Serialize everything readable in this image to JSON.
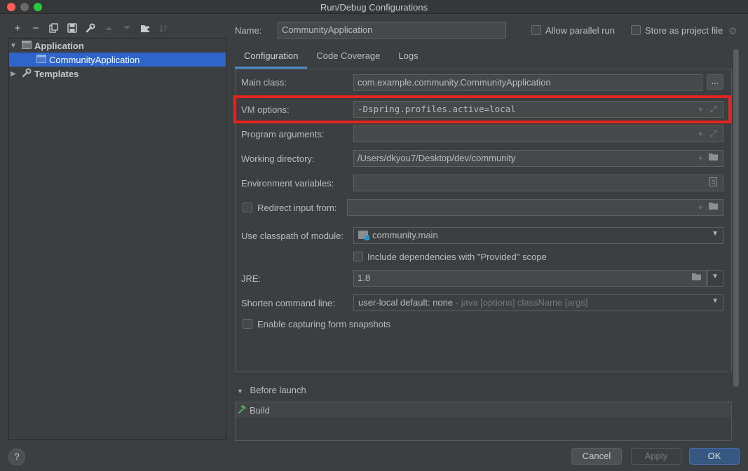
{
  "window": {
    "title": "Run/Debug Configurations"
  },
  "toolbar": {
    "add_icon": "+",
    "remove_icon": "−",
    "copy_icon": "⧉",
    "save_icon": "💾",
    "wrench_icon": "🔧",
    "up_icon": "▲",
    "down_icon": "▼",
    "folder_icon": "📁",
    "sort_icon": "⇅"
  },
  "tree": {
    "group": "Application",
    "item": "CommunityApplication",
    "templates": "Templates"
  },
  "header": {
    "name_label": "Name:",
    "name_value": "CommunityApplication",
    "allow_parallel_label": "Allow parallel run",
    "store_project_label": "Store as project file"
  },
  "tabs": [
    "Configuration",
    "Code Coverage",
    "Logs"
  ],
  "form": {
    "main_class_label": "Main class:",
    "main_class_value": "com.example.community.CommunityApplication",
    "main_class_button": "...",
    "vm_options_label": "VM options:",
    "vm_options_value": "-Dspring.profiles.active=local",
    "program_args_label": "Program arguments:",
    "program_args_value": "",
    "working_dir_label": "Working directory:",
    "working_dir_value": "/Users/dkyou7/Desktop/dev/community",
    "env_vars_label": "Environment variables:",
    "env_vars_value": "",
    "redirect_label": "Redirect input from:",
    "redirect_value": "",
    "classpath_label": "Use classpath of module:",
    "classpath_value": "community.main",
    "include_deps_label": "Include dependencies with \"Provided\" scope",
    "jre_label": "JRE:",
    "jre_value": "1.8",
    "shorten_label": "Shorten command line:",
    "shorten_value": "user-local default: none",
    "shorten_hint": " - java [options] className [args]",
    "snapshots_label": "Enable capturing form snapshots"
  },
  "before_launch": {
    "title": "Before launch",
    "task": "Build"
  },
  "buttons": {
    "help": "?",
    "cancel": "Cancel",
    "apply": "Apply",
    "ok": "OK"
  },
  "colors": {
    "selection": "#2f65ca",
    "highlight_border": "#e3241f",
    "ok_button": "#365880"
  }
}
